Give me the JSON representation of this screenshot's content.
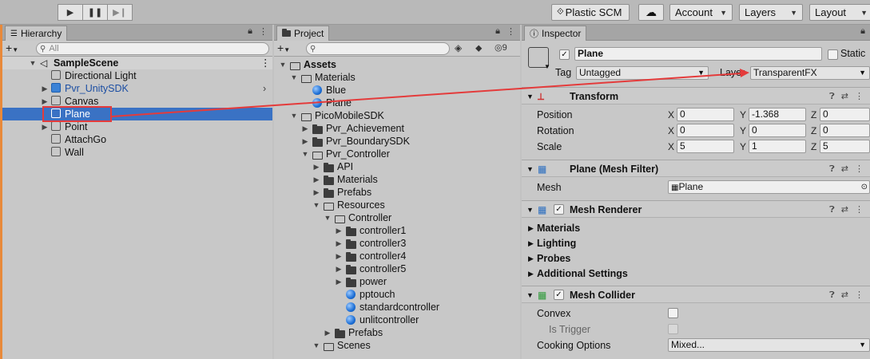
{
  "toolbar": {
    "play_icon": "play-icon",
    "pause_icon": "pause-icon",
    "step_icon": "step-icon",
    "plastic_label": "Plastic SCM",
    "cloud_icon": "cloud-icon",
    "account_label": "Account",
    "layers_label": "Layers",
    "layout_label": "Layout"
  },
  "hierarchy": {
    "tab_label": "Hierarchy",
    "search_placeholder": "All",
    "scene_name": "SampleScene",
    "items": [
      {
        "label": "Directional Light",
        "expandable": false
      },
      {
        "label": "Pvr_UnitySDK",
        "expandable": true,
        "prefab": true
      },
      {
        "label": "Canvas",
        "expandable": true
      },
      {
        "label": "Plane",
        "expandable": false,
        "selected": true
      },
      {
        "label": "Point",
        "expandable": true
      },
      {
        "label": "AttachGo",
        "expandable": false
      },
      {
        "label": "Wall",
        "expandable": false
      }
    ]
  },
  "project": {
    "tab_label": "Project",
    "eye_count": "9",
    "tree": [
      {
        "label": "Assets",
        "type": "folder-open",
        "bold": true
      },
      {
        "label": "Materials",
        "type": "folder-open"
      },
      {
        "label": "Blue",
        "type": "material"
      },
      {
        "label": "Plane",
        "type": "material"
      },
      {
        "label": "PicoMobileSDK",
        "type": "folder-open"
      },
      {
        "label": "Pvr_Achievement",
        "type": "folder"
      },
      {
        "label": "Pvr_BoundarySDK",
        "type": "folder"
      },
      {
        "label": "Pvr_Controller",
        "type": "folder-open"
      },
      {
        "label": "API",
        "type": "folder"
      },
      {
        "label": "Materials",
        "type": "folder"
      },
      {
        "label": "Prefabs",
        "type": "folder"
      },
      {
        "label": "Resources",
        "type": "folder-open"
      },
      {
        "label": "Controller",
        "type": "folder-open"
      },
      {
        "label": "controller1",
        "type": "folder"
      },
      {
        "label": "controller3",
        "type": "folder"
      },
      {
        "label": "controller4",
        "type": "folder"
      },
      {
        "label": "controller5",
        "type": "folder"
      },
      {
        "label": "power",
        "type": "folder"
      },
      {
        "label": "pptouch",
        "type": "material"
      },
      {
        "label": "standardcontroller",
        "type": "material"
      },
      {
        "label": "unlitcontroller",
        "type": "material"
      },
      {
        "label": "Prefabs",
        "type": "folder"
      },
      {
        "label": "Scenes",
        "type": "folder-open"
      }
    ]
  },
  "inspector": {
    "tab_label": "Inspector",
    "object_name": "Plane",
    "static_label": "Static",
    "tag_label": "Tag",
    "tag_value": "Untagged",
    "layer_label": "Layer",
    "layer_value": "TransparentFX",
    "transform": {
      "title": "Transform",
      "position_label": "Position",
      "rotation_label": "Rotation",
      "scale_label": "Scale",
      "position": {
        "x": "0",
        "y": "-1.368",
        "z": "0"
      },
      "rotation": {
        "x": "0",
        "y": "0",
        "z": "0"
      },
      "scale": {
        "x": "5",
        "y": "1",
        "z": "5"
      }
    },
    "mesh_filter": {
      "title": "Plane (Mesh Filter)",
      "mesh_label": "Mesh",
      "mesh_value": "Plane"
    },
    "mesh_renderer": {
      "title": "Mesh Renderer",
      "subsections": [
        "Materials",
        "Lighting",
        "Probes",
        "Additional Settings"
      ]
    },
    "mesh_collider": {
      "title": "Mesh Collider",
      "convex_label": "Convex",
      "is_trigger_label": "Is Trigger",
      "cooking_label": "Cooking Options",
      "cooking_value": "Mixed..."
    }
  },
  "axis_labels": {
    "x": "X",
    "y": "Y",
    "z": "Z"
  },
  "annotation_color": "#e43b3b"
}
